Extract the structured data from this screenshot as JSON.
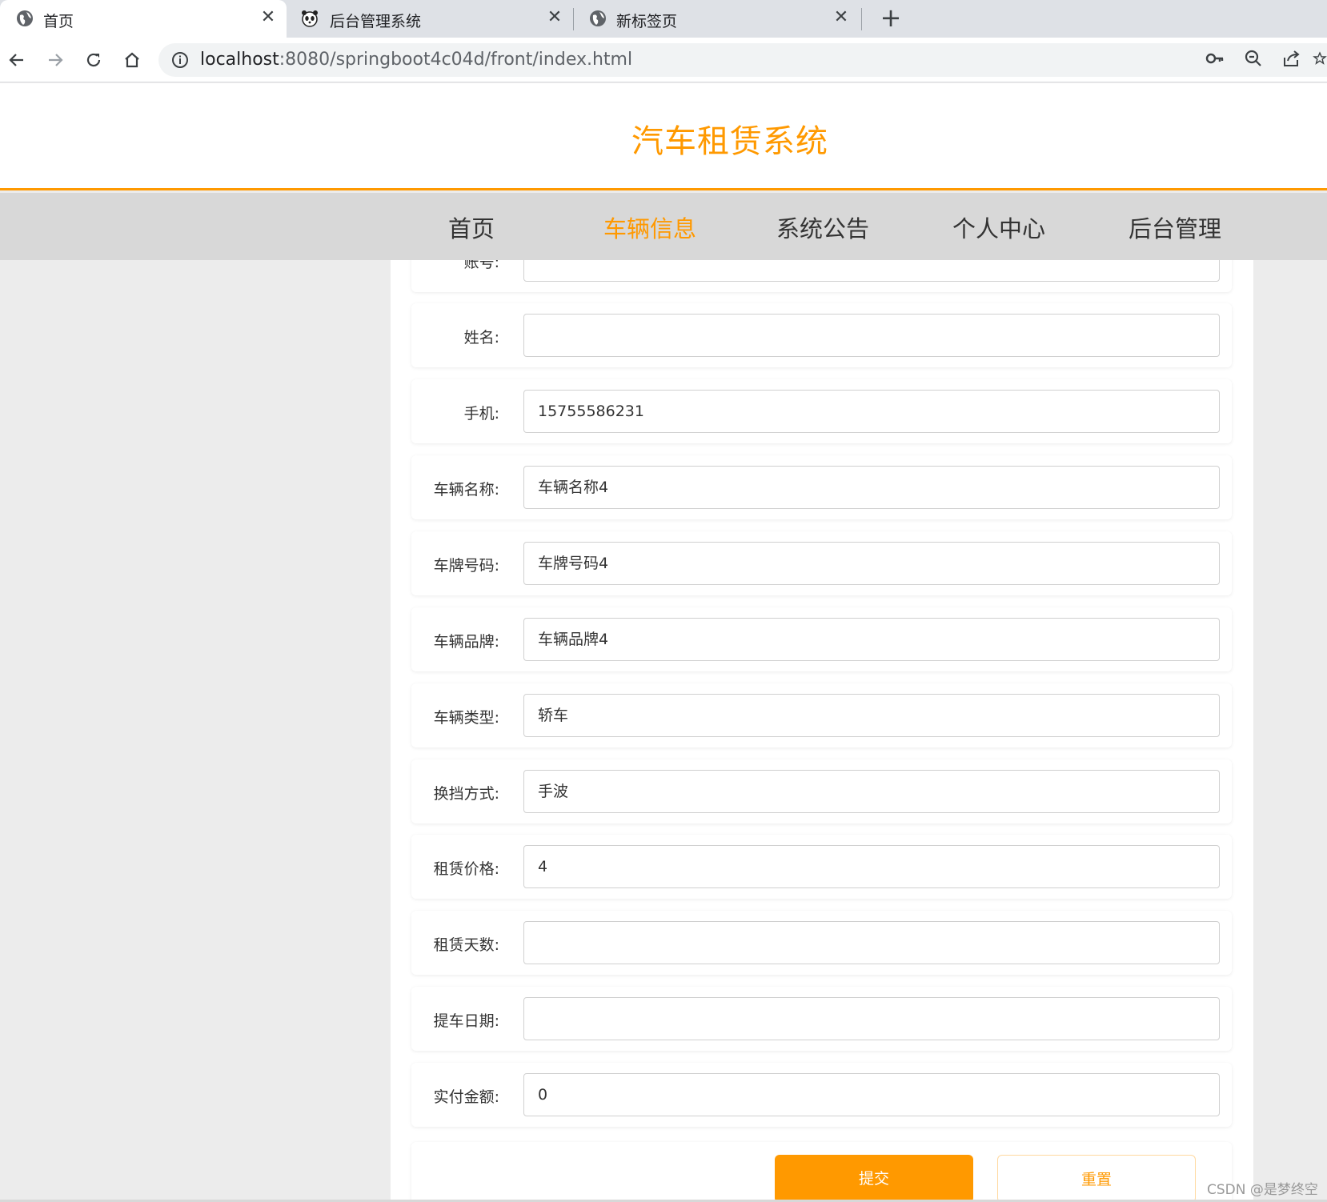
{
  "browser": {
    "tabs": [
      {
        "title": "首页",
        "active": true,
        "icon": "globe-icon"
      },
      {
        "title": "后台管理系统",
        "active": false,
        "icon": "panda-icon"
      },
      {
        "title": "新标签页",
        "active": false,
        "icon": "globe-icon"
      }
    ],
    "url": {
      "host": "localhost",
      "path": ":8080/springboot4c04d/front/index.html"
    }
  },
  "site": {
    "title": "汽车租赁系统",
    "nav": [
      {
        "label": "首页",
        "active": false
      },
      {
        "label": "车辆信息",
        "active": true
      },
      {
        "label": "系统公告",
        "active": false
      },
      {
        "label": "个人中心",
        "active": false
      },
      {
        "label": "后台管理",
        "active": false
      }
    ]
  },
  "form": {
    "fields": [
      {
        "label": "账号:",
        "value": ""
      },
      {
        "label": "姓名:",
        "value": ""
      },
      {
        "label": "手机:",
        "value": "15755586231"
      },
      {
        "label": "车辆名称:",
        "value": "车辆名称4"
      },
      {
        "label": "车牌号码:",
        "value": "车牌号码4"
      },
      {
        "label": "车辆品牌:",
        "value": "车辆品牌4"
      },
      {
        "label": "车辆类型:",
        "value": "轿车"
      },
      {
        "label": "换挡方式:",
        "value": "手波"
      },
      {
        "label": "租赁价格:",
        "value": "4"
      },
      {
        "label": "租赁天数:",
        "value": ""
      },
      {
        "label": "提车日期:",
        "value": ""
      },
      {
        "label": "实付金额:",
        "value": "0"
      }
    ],
    "submit_label": "提交",
    "reset_label": "重置"
  },
  "watermark": "CSDN @是梦终空",
  "colors": {
    "accent": "#ff9900",
    "nav_bg": "#d8d8d8",
    "page_bg": "#ececec"
  }
}
